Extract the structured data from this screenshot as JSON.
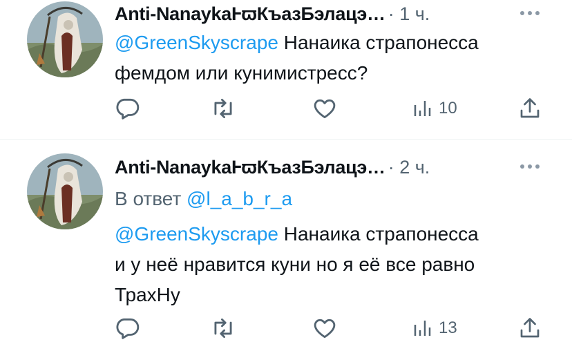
{
  "tweets": [
    {
      "author_name": "Anti-NanaykaⱵϖКъазБэлацэ…",
      "time": "· 1 ч.",
      "reply_prefix": "",
      "reply_to": "",
      "mention": "@GreenSkyscrape",
      "text_line1": " Нанаика страпонесса",
      "text_line2": "фемдом или кунимистресс?",
      "text_line3": "",
      "views": "10"
    },
    {
      "author_name": "Anti-NanaykaⱵϖКъазБэлацэ…",
      "time": "· 2 ч.",
      "reply_prefix": "В ответ ",
      "reply_to": "@l_a_b_r_a",
      "mention": "@GreenSkyscrape",
      "text_line1": " Нанаика страпонесса",
      "text_line2": "и у неё нравится куни но я её все равно",
      "text_line3": "ТрахНу",
      "views": "13"
    }
  ],
  "icons": {
    "reply": "reply-icon",
    "retweet": "retweet-icon",
    "like": "heart-icon",
    "views": "views-icon",
    "share": "share-icon",
    "more": "more-icon"
  },
  "colors": {
    "text": "#0f1419",
    "muted": "#536471",
    "link": "#1d9bf0",
    "divider": "#eff3f4"
  }
}
